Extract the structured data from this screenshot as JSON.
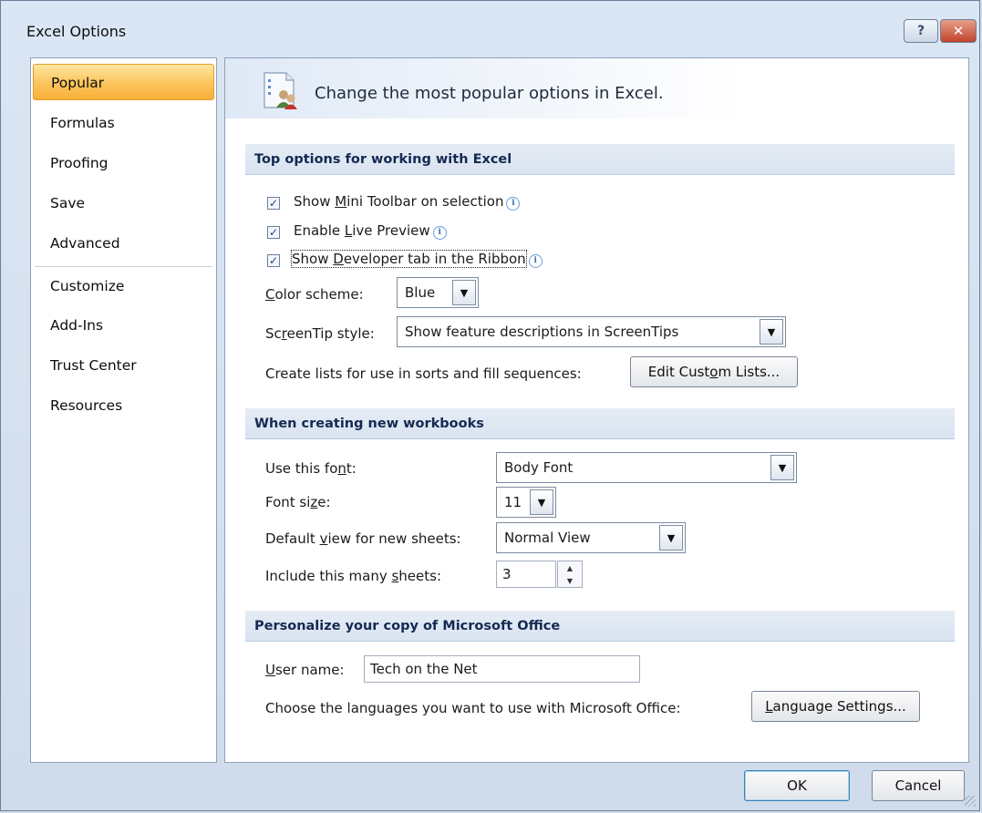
{
  "window": {
    "title": "Excel Options",
    "help_label": "?",
    "close_label": "✕"
  },
  "nav": {
    "items": [
      {
        "label": "Popular"
      },
      {
        "label": "Formulas"
      },
      {
        "label": "Proofing"
      },
      {
        "label": "Save"
      },
      {
        "label": "Advanced"
      },
      {
        "label": "Customize"
      },
      {
        "label": "Add-Ins"
      },
      {
        "label": "Trust Center"
      },
      {
        "label": "Resources"
      }
    ]
  },
  "header": {
    "text": "Change the most popular options in Excel."
  },
  "sections": {
    "top": "Top options for working with Excel",
    "new_workbooks": "When creating new workbooks",
    "personalize": "Personalize your copy of Microsoft Office"
  },
  "top_options": {
    "mini_toolbar": {
      "pre": "Show ",
      "u": "M",
      "post": "ini Toolbar on selection",
      "checked": true
    },
    "live_preview": {
      "pre": "Enable ",
      "u": "L",
      "post": "ive Preview",
      "checked": true
    },
    "developer_tab": {
      "pre": "Show ",
      "u": "D",
      "post": "eveloper tab in the Ribbon",
      "checked": true
    },
    "color_scheme": {
      "label_u": "C",
      "label_rest": "olor scheme:",
      "value": "Blue"
    },
    "screentip": {
      "label_pre": "Sc",
      "label_u": "r",
      "label_post": "eenTip style:",
      "value": "Show feature descriptions in ScreenTips"
    },
    "custom_lists": {
      "label": "Create lists for use in sorts and fill sequences:",
      "btn_pre": "Edit Cust",
      "btn_u": "o",
      "btn_post": "m Lists..."
    }
  },
  "new_workbooks": {
    "font": {
      "label_pre": "Use this fo",
      "label_u": "n",
      "label_post": "t:",
      "value": "Body Font"
    },
    "font_size": {
      "label_pre": "Font si",
      "label_u": "z",
      "label_post": "e:",
      "value": "11"
    },
    "default_view": {
      "label_pre": "Default ",
      "label_u": "v",
      "label_post": "iew for new sheets:",
      "value": "Normal View"
    },
    "sheets": {
      "label_pre": "Include this many ",
      "label_u": "s",
      "label_post": "heets:",
      "value": "3"
    }
  },
  "personalize": {
    "user_name": {
      "label_u": "U",
      "label_rest": "ser name:",
      "value": "Tech on the Net"
    },
    "languages": {
      "label": "Choose the languages you want to use with Microsoft Office:",
      "btn_u": "L",
      "btn_rest": "anguage Settings..."
    }
  },
  "footer": {
    "ok": "OK",
    "cancel": "Cancel"
  },
  "icons": {
    "check": "✓",
    "info": "i",
    "dropdown": "▼",
    "spin_up": "▲",
    "spin_down": "▼"
  },
  "colors": {
    "active_nav": "#fbc45a",
    "section_text": "#152a52"
  }
}
